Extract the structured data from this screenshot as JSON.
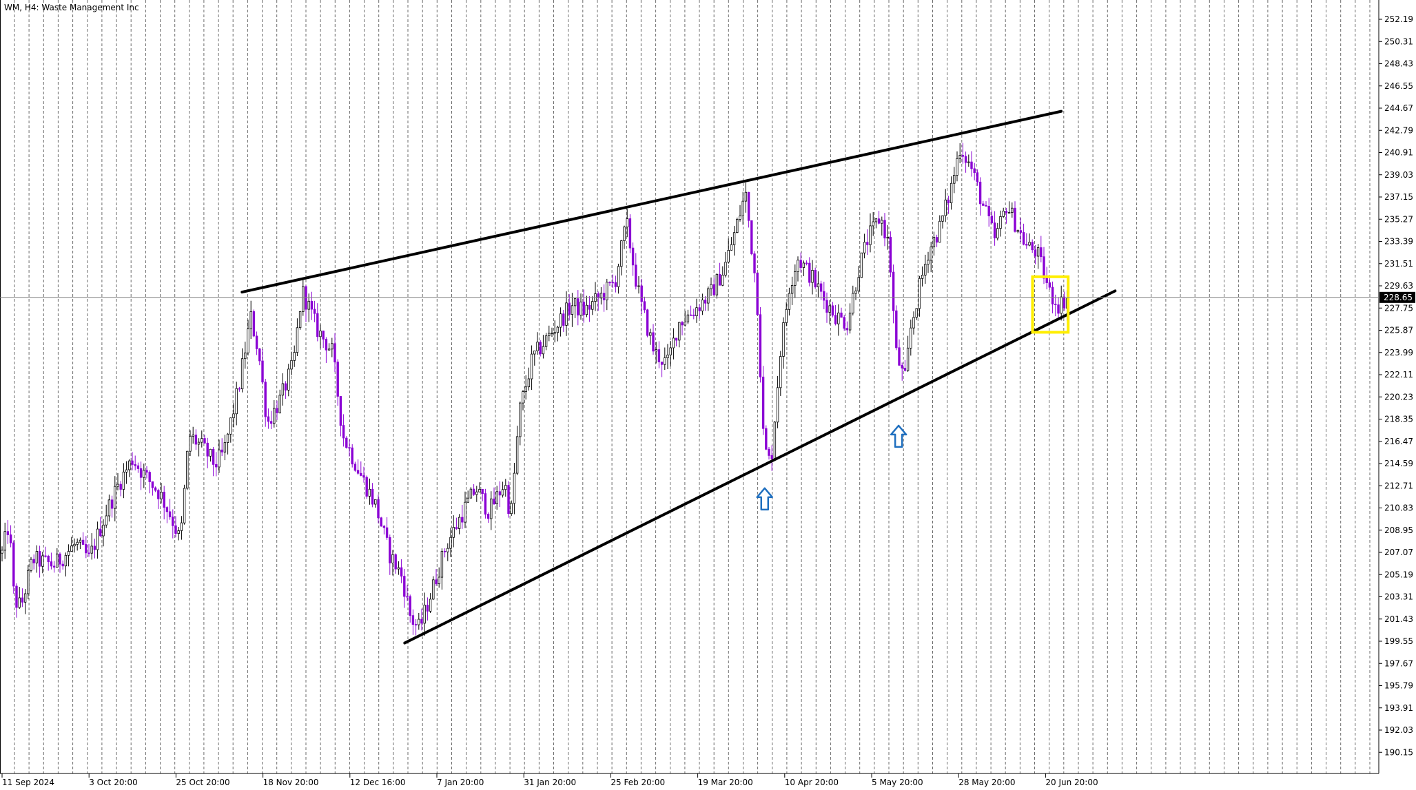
{
  "chart_data": {
    "type": "candlestick",
    "title": "WM, H4:  Waste Management Inc",
    "symbol": "WM",
    "timeframe": "H4",
    "instrument": "Waste Management Inc",
    "current_price": "228.65",
    "y_ticks": [
      "252.19",
      "250.31",
      "248.43",
      "246.55",
      "244.67",
      "242.79",
      "240.91",
      "239.03",
      "237.15",
      "235.27",
      "233.39",
      "231.51",
      "229.63",
      "227.75",
      "225.87",
      "223.99",
      "222.11",
      "220.23",
      "218.35",
      "216.47",
      "214.59",
      "212.71",
      "210.83",
      "208.95",
      "207.07",
      "205.19",
      "203.31",
      "201.43",
      "199.55",
      "197.67",
      "195.79",
      "193.91",
      "192.03",
      "190.15"
    ],
    "ylim": [
      189.0,
      253.5
    ],
    "x_ticks": [
      "11 Sep 2024",
      "3 Oct 20:00",
      "25 Oct 20:00",
      "18 Nov 20:00",
      "12 Dec 16:00",
      "7 Jan 20:00",
      "31 Jan 20:00",
      "25 Feb 20:00",
      "19 Mar 20:00",
      "10 Apr 20:00",
      "5 May 20:00",
      "28 May 20:00",
      "20 Jun 20:00"
    ],
    "grid": "vertical-dashed",
    "price_path": [
      [
        0,
        207.0
      ],
      [
        0.08,
        209.5
      ],
      [
        0.14,
        203.0
      ],
      [
        0.22,
        202.5
      ],
      [
        0.35,
        206.5
      ],
      [
        0.6,
        206.0
      ],
      [
        0.85,
        207.8
      ],
      [
        1.0,
        206.5
      ],
      [
        1.2,
        210.5
      ],
      [
        1.35,
        213.0
      ],
      [
        1.5,
        215.0
      ],
      [
        1.65,
        213.5
      ],
      [
        1.82,
        212.0
      ],
      [
        1.95,
        210.0
      ],
      [
        2.05,
        208.0
      ],
      [
        2.15,
        217.0
      ],
      [
        2.3,
        216.0
      ],
      [
        2.45,
        214.5
      ],
      [
        2.55,
        215.5
      ],
      [
        2.72,
        221.0
      ],
      [
        2.86,
        227.0
      ],
      [
        2.95,
        224.0
      ],
      [
        3.05,
        218.0
      ],
      [
        3.2,
        220.0
      ],
      [
        3.35,
        223.0
      ],
      [
        3.45,
        229.2
      ],
      [
        3.52,
        228.0
      ],
      [
        3.62,
        226.0
      ],
      [
        3.8,
        224.0
      ],
      [
        3.92,
        217.0
      ],
      [
        4.1,
        214.0
      ],
      [
        4.3,
        211.0
      ],
      [
        4.45,
        207.0
      ],
      [
        4.6,
        205.0
      ],
      [
        4.7,
        201.5
      ],
      [
        4.8,
        200.6
      ],
      [
        4.95,
        204.0
      ],
      [
        5.1,
        207.5
      ],
      [
        5.3,
        210.5
      ],
      [
        5.45,
        212.5
      ],
      [
        5.6,
        210.5
      ],
      [
        5.78,
        213.0
      ],
      [
        5.85,
        210.0
      ],
      [
        5.95,
        219.0
      ],
      [
        6.1,
        223.5
      ],
      [
        6.3,
        225.5
      ],
      [
        6.55,
        228.0
      ],
      [
        6.7,
        227.5
      ],
      [
        6.92,
        229.0
      ],
      [
        7.05,
        230.0
      ],
      [
        7.18,
        235.0
      ],
      [
        7.28,
        230.5
      ],
      [
        7.35,
        228.0
      ],
      [
        7.5,
        224.0
      ],
      [
        7.65,
        223.0
      ],
      [
        7.78,
        226.5
      ],
      [
        7.95,
        227.5
      ],
      [
        8.15,
        229.0
      ],
      [
        8.3,
        231.0
      ],
      [
        8.42,
        234.0
      ],
      [
        8.55,
        237.5
      ],
      [
        8.68,
        229.0
      ],
      [
        8.76,
        216.0
      ],
      [
        8.84,
        214.5
      ],
      [
        8.95,
        224.0
      ],
      [
        9.05,
        229.5
      ],
      [
        9.15,
        232.0
      ],
      [
        9.3,
        230.5
      ],
      [
        9.45,
        228.5
      ],
      [
        9.6,
        227.0
      ],
      [
        9.72,
        226.5
      ],
      [
        9.85,
        231.0
      ],
      [
        9.95,
        233.5
      ],
      [
        10.1,
        235.5
      ],
      [
        10.2,
        233.0
      ],
      [
        10.28,
        224.0
      ],
      [
        10.38,
        221.5
      ],
      [
        10.45,
        226.0
      ],
      [
        10.55,
        229.5
      ],
      [
        10.65,
        232.5
      ],
      [
        10.78,
        234.5
      ],
      [
        10.9,
        237.5
      ],
      [
        11.02,
        241.5
      ],
      [
        11.15,
        239.5
      ],
      [
        11.3,
        236.0
      ],
      [
        11.42,
        233.5
      ],
      [
        11.55,
        236.5
      ],
      [
        11.65,
        235.0
      ],
      [
        11.78,
        233.0
      ],
      [
        11.9,
        232.5
      ],
      [
        12.05,
        229.0
      ],
      [
        12.15,
        228.0
      ],
      [
        12.25,
        228.65
      ]
    ],
    "trendlines": [
      {
        "name": "upper-channel-line",
        "start": [
          2.76,
          229.1
        ],
        "end": [
          12.18,
          244.4
        ]
      },
      {
        "name": "lower-channel-line",
        "start": [
          4.63,
          199.4
        ],
        "end": [
          12.8,
          229.2
        ]
      }
    ],
    "annotations": [
      {
        "type": "arrow-up",
        "x": 8.77,
        "y": 212.5,
        "color": "#1f6fbf"
      },
      {
        "type": "arrow-up",
        "x": 10.31,
        "y": 217.8,
        "color": "#1f6fbf"
      },
      {
        "type": "box",
        "x0": 11.85,
        "x1": 12.26,
        "y0": 225.7,
        "y1": 230.4,
        "color": "#ffee00"
      }
    ],
    "colors": {
      "bull": "#000000",
      "bear": "#8a00d4",
      "grid": "#6b6b6b",
      "price_line": "#808080"
    }
  }
}
